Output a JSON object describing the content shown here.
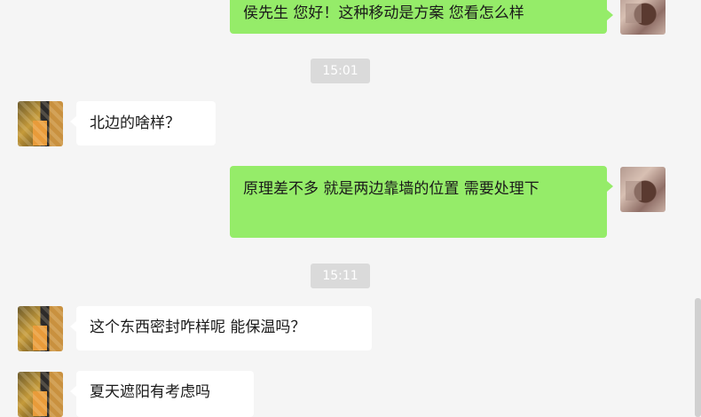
{
  "messages": {
    "m1": {
      "text": "侯先生 您好！这种移动是方案 您看怎么样"
    },
    "t1": {
      "text": "15:01"
    },
    "m2": {
      "text": "北边的啥样？"
    },
    "m3": {
      "text": "原理差不多 就是两边靠墙的位置 需要处理下"
    },
    "t2": {
      "text": "15:11"
    },
    "m4": {
      "text": "这个东西密封咋样呢 能保温吗？"
    },
    "m5": {
      "text": "夏天遮阳有考虑吗"
    }
  },
  "colors": {
    "background": "#f5f5f5",
    "outgoing_bubble": "#95ec69",
    "incoming_bubble": "#ffffff",
    "timestamp_bg": "#dadada"
  }
}
